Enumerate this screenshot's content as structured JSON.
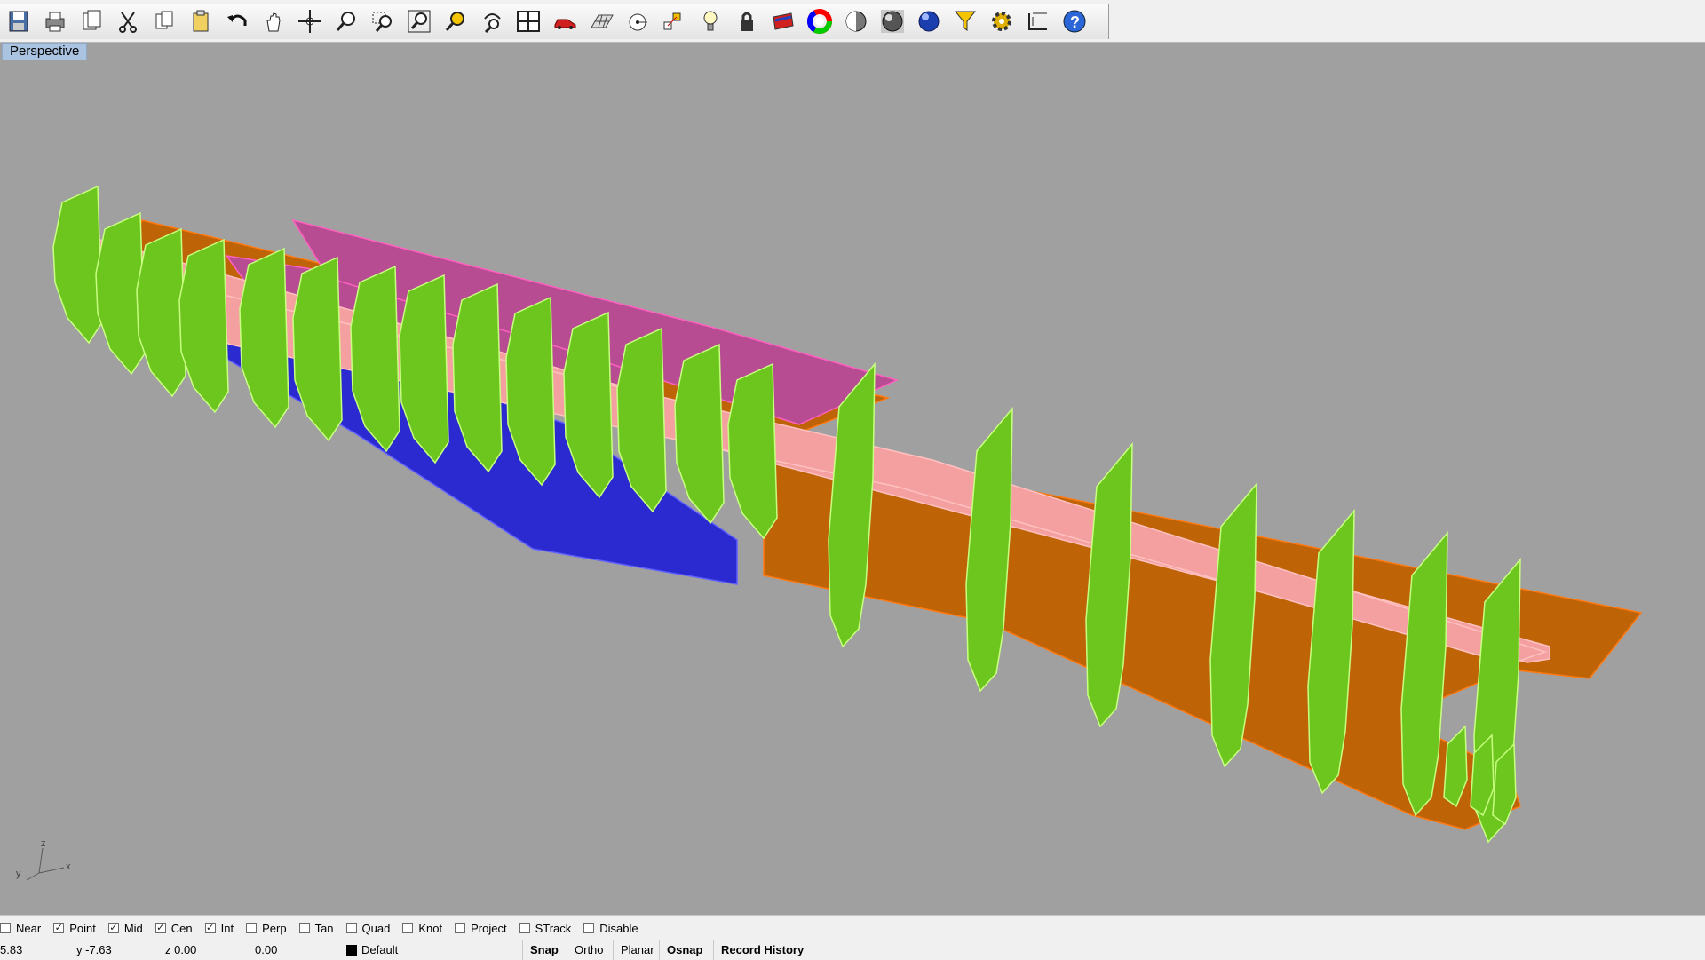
{
  "toolbar": {
    "icons": [
      "save-icon",
      "print-icon",
      "copy-doc-icon",
      "cut-icon",
      "copy-icon",
      "paste-icon",
      "undo-icon",
      "pan-hand-icon",
      "rotate-view-icon",
      "zoom-icon",
      "zoom-window-icon",
      "zoom-extents-icon",
      "zoom-selected-icon",
      "undo-view-icon",
      "four-viewports-icon",
      "car-icon",
      "grid-icon",
      "point-icon",
      "object-snap-icon",
      "light-icon",
      "lock-icon",
      "properties-icon",
      "color-wheel-icon",
      "shaded-sphere-icon",
      "rendered-sphere-icon",
      "blue-sphere-icon",
      "select-filter-icon",
      "options-gear-icon",
      "dimension-icon",
      "help-icon"
    ]
  },
  "viewport": {
    "title": "Perspective",
    "background": "#a0a0a0",
    "axes": {
      "x": "x",
      "y": "y",
      "z": "z"
    }
  },
  "colors": {
    "frames": "#6cc61e",
    "shell": "#bf6307",
    "deck": "#f5a0a0",
    "bulkhead": "#b84c92",
    "bottom_plates": "#2a2ad0"
  },
  "osnap": [
    {
      "label": "Near",
      "checked": false
    },
    {
      "label": "Point",
      "checked": true
    },
    {
      "label": "Mid",
      "checked": true
    },
    {
      "label": "Cen",
      "checked": true
    },
    {
      "label": "Int",
      "checked": true
    },
    {
      "label": "Perp",
      "checked": false
    },
    {
      "label": "Tan",
      "checked": false
    },
    {
      "label": "Quad",
      "checked": false
    },
    {
      "label": "Knot",
      "checked": false
    },
    {
      "label": "Project",
      "checked": false
    },
    {
      "label": "STrack",
      "checked": false
    },
    {
      "label": "Disable",
      "checked": false
    }
  ],
  "status": {
    "x": "5.83",
    "y": "y -7.63",
    "z": "z 0.00",
    "extra": "0.00",
    "layer": "Default",
    "panes": [
      "Snap",
      "Ortho",
      "Planar",
      "Osnap",
      "Record History"
    ]
  }
}
